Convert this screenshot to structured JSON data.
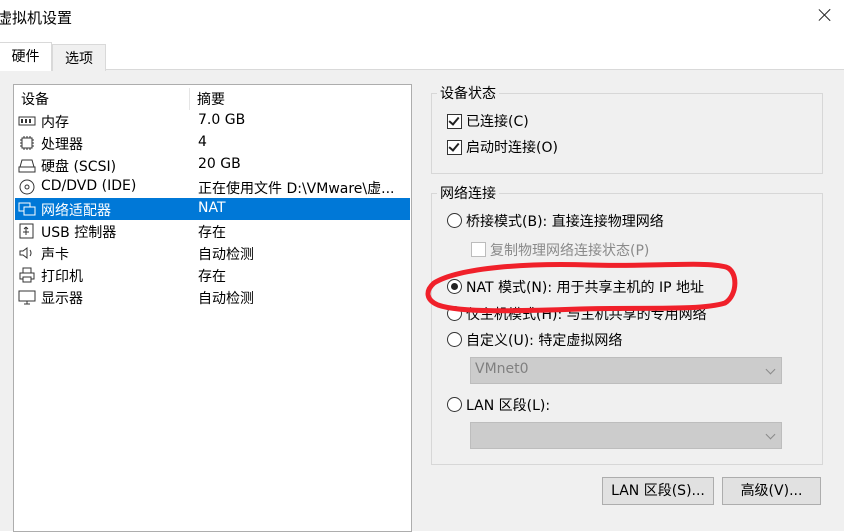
{
  "window": {
    "title": "虚拟机设置"
  },
  "tabs": [
    {
      "label": "硬件"
    },
    {
      "label": "选项"
    }
  ],
  "device_list": {
    "headers": {
      "device": "设备",
      "summary": "摘要"
    },
    "rows": [
      {
        "icon": "memory-icon",
        "name": "内存",
        "summary": "7.0 GB"
      },
      {
        "icon": "processor-icon",
        "name": "处理器",
        "summary": "4"
      },
      {
        "icon": "hard-disk-icon",
        "name": "硬盘 (SCSI)",
        "summary": "20 GB"
      },
      {
        "icon": "cd-dvd-icon",
        "name": "CD/DVD (IDE)",
        "summary": "正在使用文件 D:\\VMware\\虚..."
      },
      {
        "icon": "network-adapter-icon",
        "name": "网络适配器",
        "summary": "NAT"
      },
      {
        "icon": "usb-icon",
        "name": "USB 控制器",
        "summary": "存在"
      },
      {
        "icon": "sound-icon",
        "name": "声卡",
        "summary": "自动检测"
      },
      {
        "icon": "printer-icon",
        "name": "打印机",
        "summary": "存在"
      },
      {
        "icon": "display-icon",
        "name": "显示器",
        "summary": "自动检测"
      }
    ],
    "selected_index": 4
  },
  "device_status": {
    "title": "设备状态",
    "connected": {
      "label": "已连接(C)",
      "checked": true
    },
    "connect_at_power_on": {
      "label": "启动时连接(O)",
      "checked": true
    }
  },
  "network_connection": {
    "title": "网络连接",
    "bridged": {
      "label": "桥接模式(B): 直接连接物理网络",
      "selected": false
    },
    "replicate": {
      "label": "复制物理网络连接状态(P)",
      "checked": false,
      "disabled": true
    },
    "nat": {
      "label": "NAT 模式(N): 用于共享主机的 IP 地址",
      "selected": true
    },
    "host_only": {
      "label": "仅主机模式(H): 与主机共享的专用网络",
      "selected": false
    },
    "custom": {
      "label": "自定义(U): 特定虚拟网络",
      "selected": false
    },
    "custom_network": {
      "value": "VMnet0"
    },
    "lan_segment": {
      "label": "LAN 区段(L):",
      "selected": false
    },
    "lan_segment_value": {
      "value": ""
    }
  },
  "buttons": {
    "lan_segments": "LAN 区段(S)...",
    "advanced": "高级(V)..."
  },
  "annotation": {
    "color": "#f0202a"
  }
}
